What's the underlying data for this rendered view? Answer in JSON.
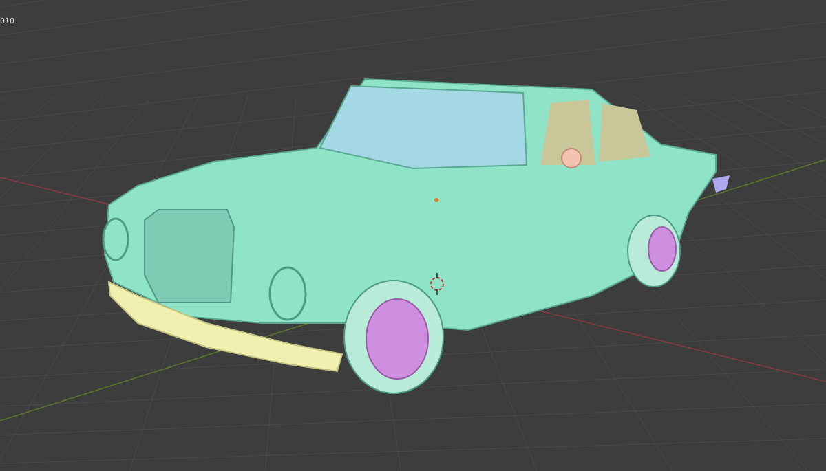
{
  "viewport": {
    "object_label": "010"
  }
}
